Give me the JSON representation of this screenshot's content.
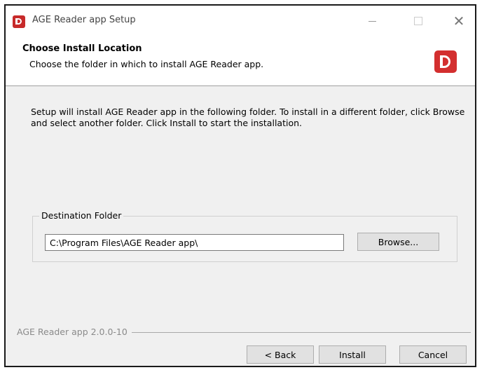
{
  "window": {
    "title": "AGE Reader app Setup",
    "icon": "app-logo-icon",
    "controls": {
      "minimize": "minimize-icon",
      "maximize": "maximize-icon",
      "close": "close-icon",
      "close_glyph": "✕"
    }
  },
  "header": {
    "title": "Choose Install Location",
    "subtitle": "Choose the folder in which to install AGE Reader app."
  },
  "body": {
    "description": "Setup will install AGE Reader app in the following folder. To install in a different folder, click Browse and select another folder. Click Install to start the installation."
  },
  "destination": {
    "group_label": "Destination Folder",
    "path_value": "C:\\Program Files\\AGE Reader app\\",
    "browse_label": "Browse..."
  },
  "footer": {
    "branding": "AGE Reader app 2.0.0-10",
    "back_label": "< Back",
    "install_label": "Install",
    "cancel_label": "Cancel"
  },
  "colors": {
    "brand": "#d32f2f",
    "dialog_bg": "#f0f0f0",
    "button_bg": "#e1e1e1"
  }
}
